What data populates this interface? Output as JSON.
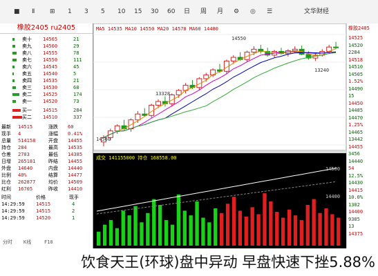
{
  "topbar": {
    "status_text": "文华财经",
    "items": [
      "■",
      "Ⅱ",
      "⊞",
      "1",
      "3",
      "5",
      "10",
      "15",
      "30",
      "60",
      "日",
      "周",
      "月",
      "⚙",
      "◎",
      "☰"
    ]
  },
  "left_panel": {
    "title": "橡胶2405 ru2405",
    "asks": [
      {
        "label": "卖十",
        "price": "14565",
        "vol": "21"
      },
      {
        "label": "卖九",
        "price": "14560",
        "vol": "29"
      },
      {
        "label": "卖八",
        "price": "14555",
        "vol": "78"
      },
      {
        "label": "卖七",
        "price": "14550",
        "vol": "111"
      },
      {
        "label": "卖六",
        "price": "14545",
        "vol": "45"
      },
      {
        "label": "卖五",
        "price": "14540",
        "vol": "5"
      },
      {
        "label": "卖四",
        "price": "14535",
        "vol": "21"
      },
      {
        "label": "卖三",
        "price": "14530",
        "vol": "68"
      },
      {
        "label": "卖二",
        "price": "14525",
        "vol": "174"
      },
      {
        "label": "卖一",
        "price": "14520",
        "vol": "73"
      }
    ],
    "bids": [
      {
        "label": "买一",
        "price": "14515",
        "vol": "284"
      },
      {
        "label": "买二",
        "price": "14510",
        "vol": "337"
      }
    ],
    "stats": [
      {
        "l1": "最新",
        "v1": "14515",
        "l2": "涨跌",
        "v2": "60"
      },
      {
        "l1": "现手",
        "v1": "4",
        "l2": "涨幅",
        "v2": "0.41%"
      },
      {
        "l1": "总量",
        "v1": "514158",
        "l2": "开盘",
        "v2": "14455"
      },
      {
        "l1": "持仓",
        "v1": "284",
        "l2": "最高",
        "v2": "14535"
      },
      {
        "l1": "仓差",
        "v1": "2703",
        "l2": "最低",
        "v2": "14385"
      },
      {
        "l1": "日增",
        "v1": "265181",
        "l2": "昨结",
        "v2": "14455"
      },
      {
        "l1": "外盘",
        "v1": "14640",
        "l2": "内盘",
        "v2": "14440"
      },
      {
        "l1": "比例",
        "v1": "40%",
        "l2": "结算",
        "v2": "14477"
      },
      {
        "l1": "比仓",
        "v1": "262877",
        "l2": "均价",
        "v2": "14509"
      },
      {
        "l1": "红利",
        "v1": "16705",
        "l2": "昨收",
        "v2": "14410"
      }
    ],
    "trades_header": [
      "时间",
      "价格",
      "现手"
    ],
    "trades": [
      {
        "t": "14:29:59",
        "p": "14515",
        "v": "4"
      },
      {
        "t": "14:29:59",
        "p": "14515",
        "v": "2"
      },
      {
        "t": "14:29:59",
        "p": "14520",
        "v": "1"
      }
    ],
    "tabs": [
      "分时",
      "K线",
      "F10"
    ]
  },
  "chart_data": [
    {
      "type": "candlestick",
      "title": "",
      "legend_text": "MA5 14535 MA10 14550 MA20 14570 MA60 14480",
      "annotations": [
        "14550",
        "13328",
        "13240",
        "14560"
      ],
      "ylim": [
        13200,
        14700
      ],
      "candles": [
        [
          13240,
          13330,
          13180,
          13300
        ],
        [
          13300,
          13420,
          13260,
          13390
        ],
        [
          13390,
          13480,
          13350,
          13460
        ],
        [
          13460,
          13540,
          13400,
          13420
        ],
        [
          13420,
          13560,
          13380,
          13540
        ],
        [
          13540,
          13660,
          13500,
          13620
        ],
        [
          13620,
          13700,
          13580,
          13600
        ],
        [
          13600,
          13760,
          13570,
          13740
        ],
        [
          13740,
          13820,
          13700,
          13790
        ],
        [
          13790,
          13860,
          13720,
          13760
        ],
        [
          13760,
          13900,
          13720,
          13880
        ],
        [
          13880,
          13960,
          13840,
          13940
        ],
        [
          13940,
          14040,
          13900,
          14010
        ],
        [
          14010,
          14080,
          13960,
          13980
        ],
        [
          13980,
          14120,
          13950,
          14100
        ],
        [
          14100,
          14180,
          14060,
          14150
        ],
        [
          14150,
          14240,
          14120,
          14220
        ],
        [
          14220,
          14300,
          14180,
          14200
        ],
        [
          14200,
          14360,
          14170,
          14340
        ],
        [
          14340,
          14420,
          14300,
          14390
        ],
        [
          14390,
          14460,
          14340,
          14360
        ],
        [
          14360,
          14480,
          14330,
          14460
        ],
        [
          14460,
          14540,
          14420,
          14500
        ],
        [
          14500,
          14560,
          14440,
          14470
        ],
        [
          14470,
          14520,
          14400,
          14420
        ],
        [
          14420,
          14490,
          14380,
          14470
        ],
        [
          14470,
          14520,
          14430,
          14440
        ],
        [
          14440,
          14500,
          14400,
          14480
        ],
        [
          14480,
          14540,
          14450,
          14500
        ],
        [
          14500,
          14550,
          14420,
          14430
        ],
        [
          14430,
          14470,
          14360,
          14380
        ],
        [
          14380,
          14440,
          14340,
          14420
        ],
        [
          14420,
          14500,
          14400,
          14470
        ],
        [
          14470,
          14560,
          14440,
          14530
        ],
        [
          14530,
          14600,
          14500,
          14520
        ]
      ]
    },
    {
      "type": "line",
      "title": "",
      "legend_text": "成交 141155000 持仓 168558.00",
      "ylim": [
        14300,
        14600
      ],
      "annotations": [
        "14500",
        "14400"
      ],
      "bars": [
        12,
        18,
        22,
        15,
        30,
        26,
        34,
        20,
        28,
        40,
        35,
        22,
        18,
        44,
        30,
        26,
        38,
        24,
        20,
        32,
        28,
        36,
        42,
        30,
        25,
        33,
        27,
        45,
        38,
        29,
        24,
        31,
        26,
        22,
        35,
        40,
        28,
        32,
        27,
        24
      ]
    }
  ],
  "right_panel": {
    "header": "橡胶2405",
    "rows": [
      "14525",
      "14520",
      "2284",
      "14518",
      "14510",
      "14505",
      "1.52%",
      "14490",
      "15",
      "14450",
      "14485",
      "14470",
      "1.25%",
      "14465",
      "13442",
      "14455",
      "3456",
      "14440",
      "54",
      "12.5%",
      "14430",
      "14415",
      "10.0%",
      "1302",
      "14400",
      "9385",
      "13",
      "14375"
    ]
  },
  "caption": "饮食天王(环球)盘中异动 早盘快速下挫5.88%"
}
